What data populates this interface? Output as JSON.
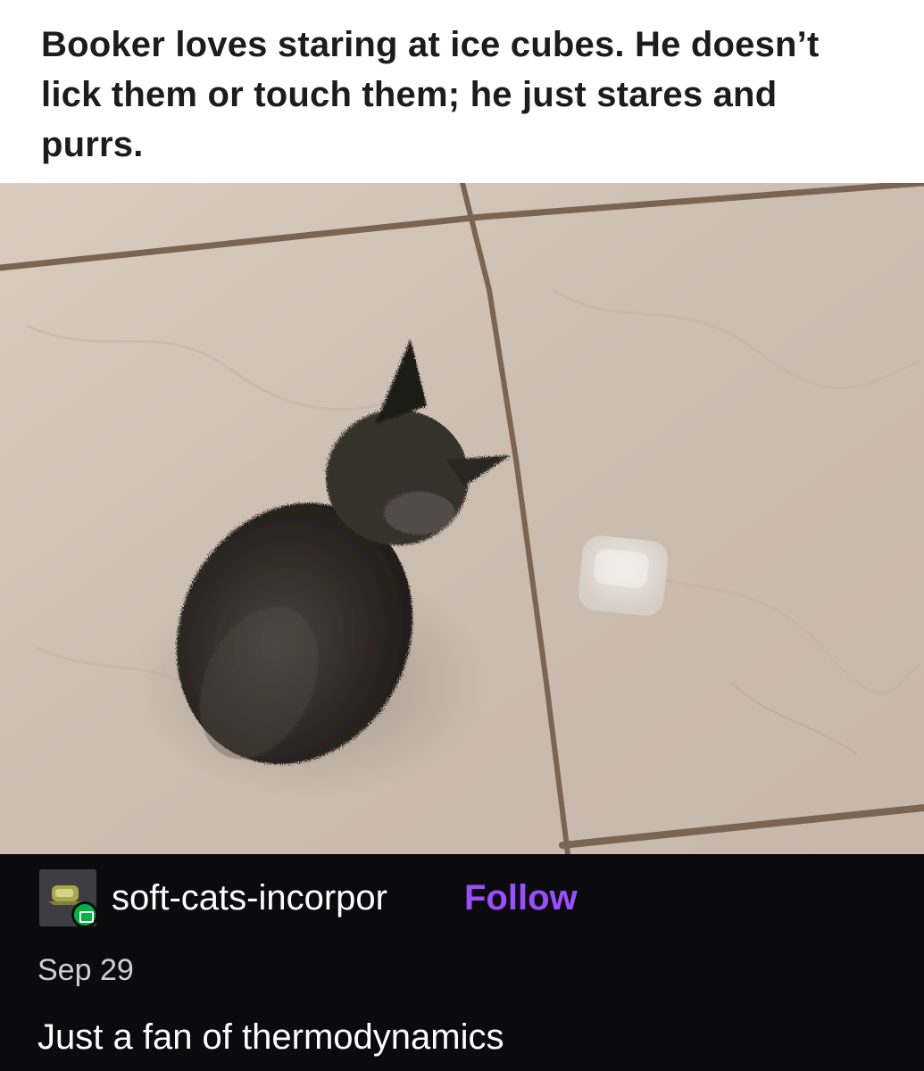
{
  "caption": {
    "text": "Booker loves staring at ice cubes. He doesn’t lick them or touch them; he just stares and purrs."
  },
  "post": {
    "username": "soft-cats-incorpor",
    "follow_label": "Follow",
    "date": "Sep 29",
    "body": "Just a fan of thermodynamics"
  },
  "colors": {
    "follow_accent": "#9b4dff",
    "badge_green": "#00b341",
    "footer_background": "#0b0b0d",
    "caption_background": "#ffffff"
  },
  "icons": {
    "avatar": "avatar-image",
    "badge": "activity-badge-icon"
  }
}
